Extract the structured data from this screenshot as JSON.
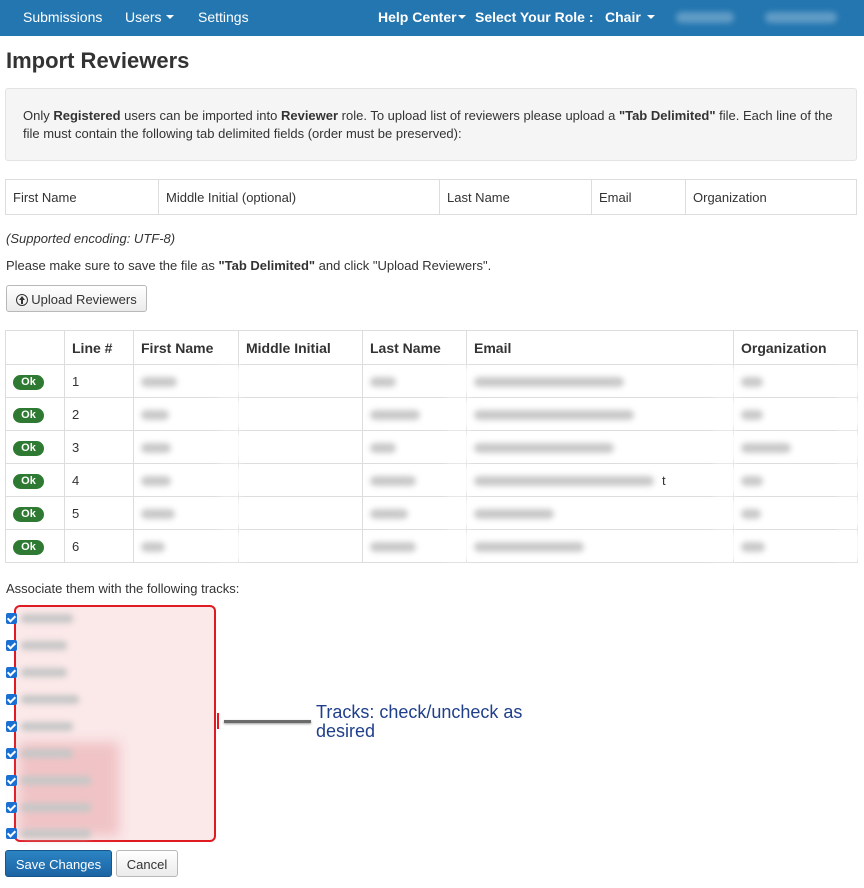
{
  "navbar": {
    "submissions": "Submissions",
    "users": "Users",
    "settings": "Settings",
    "help_center": "Help Center",
    "select_role": "Select Your Role :",
    "role": "Chair"
  },
  "page_title": "Import Reviewers",
  "info": {
    "t1": "Only ",
    "b1": "Registered",
    "t2": " users can be imported into ",
    "b2": "Reviewer",
    "t3": " role. To upload list of reviewers please upload a ",
    "b3": "\"Tab Delimited\"",
    "t4": " file. Each line of the file must contain the following tab delimited fields (order must be preserved):"
  },
  "fields": [
    "First Name",
    "Middle Initial (optional)",
    "Last Name",
    "Email",
    "Organization"
  ],
  "encoding_note": "(Supported encoding: UTF-8)",
  "save_note": {
    "t1": "Please make sure to save the file as ",
    "b1": "\"Tab Delimited\"",
    "t2": " and click \"Upload Reviewers\"."
  },
  "upload_button": "Upload Reviewers",
  "preview_table": {
    "headers": [
      "",
      "Line #",
      "First Name",
      "Middle Initial",
      "Last Name",
      "Email",
      "Organization"
    ],
    "rows": [
      {
        "status": "Ok",
        "line": "1"
      },
      {
        "status": "Ok",
        "line": "2"
      },
      {
        "status": "Ok",
        "line": "3"
      },
      {
        "status": "Ok",
        "line": "4",
        "email_tail": "t"
      },
      {
        "status": "Ok",
        "line": "5"
      },
      {
        "status": "Ok",
        "line": "6"
      }
    ]
  },
  "associate_label": "Associate them with the following tracks:",
  "tracks": {
    "count_checked": 9
  },
  "annotation": "Tracks: check/uncheck as desired",
  "buttons": {
    "save": "Save Changes",
    "cancel": "Cancel"
  },
  "colors": {
    "navbar": "#2476b0",
    "ok_badge": "#2e7a32",
    "primary_button": "#1c64a4",
    "highlight_border": "#e01a22",
    "annotation_text": "#1f3f8a"
  },
  "icons": {
    "upload": "circle-arrow-up-icon",
    "dropdown": "caret-down-icon",
    "checkbox": "checkbox-checked-icon"
  }
}
